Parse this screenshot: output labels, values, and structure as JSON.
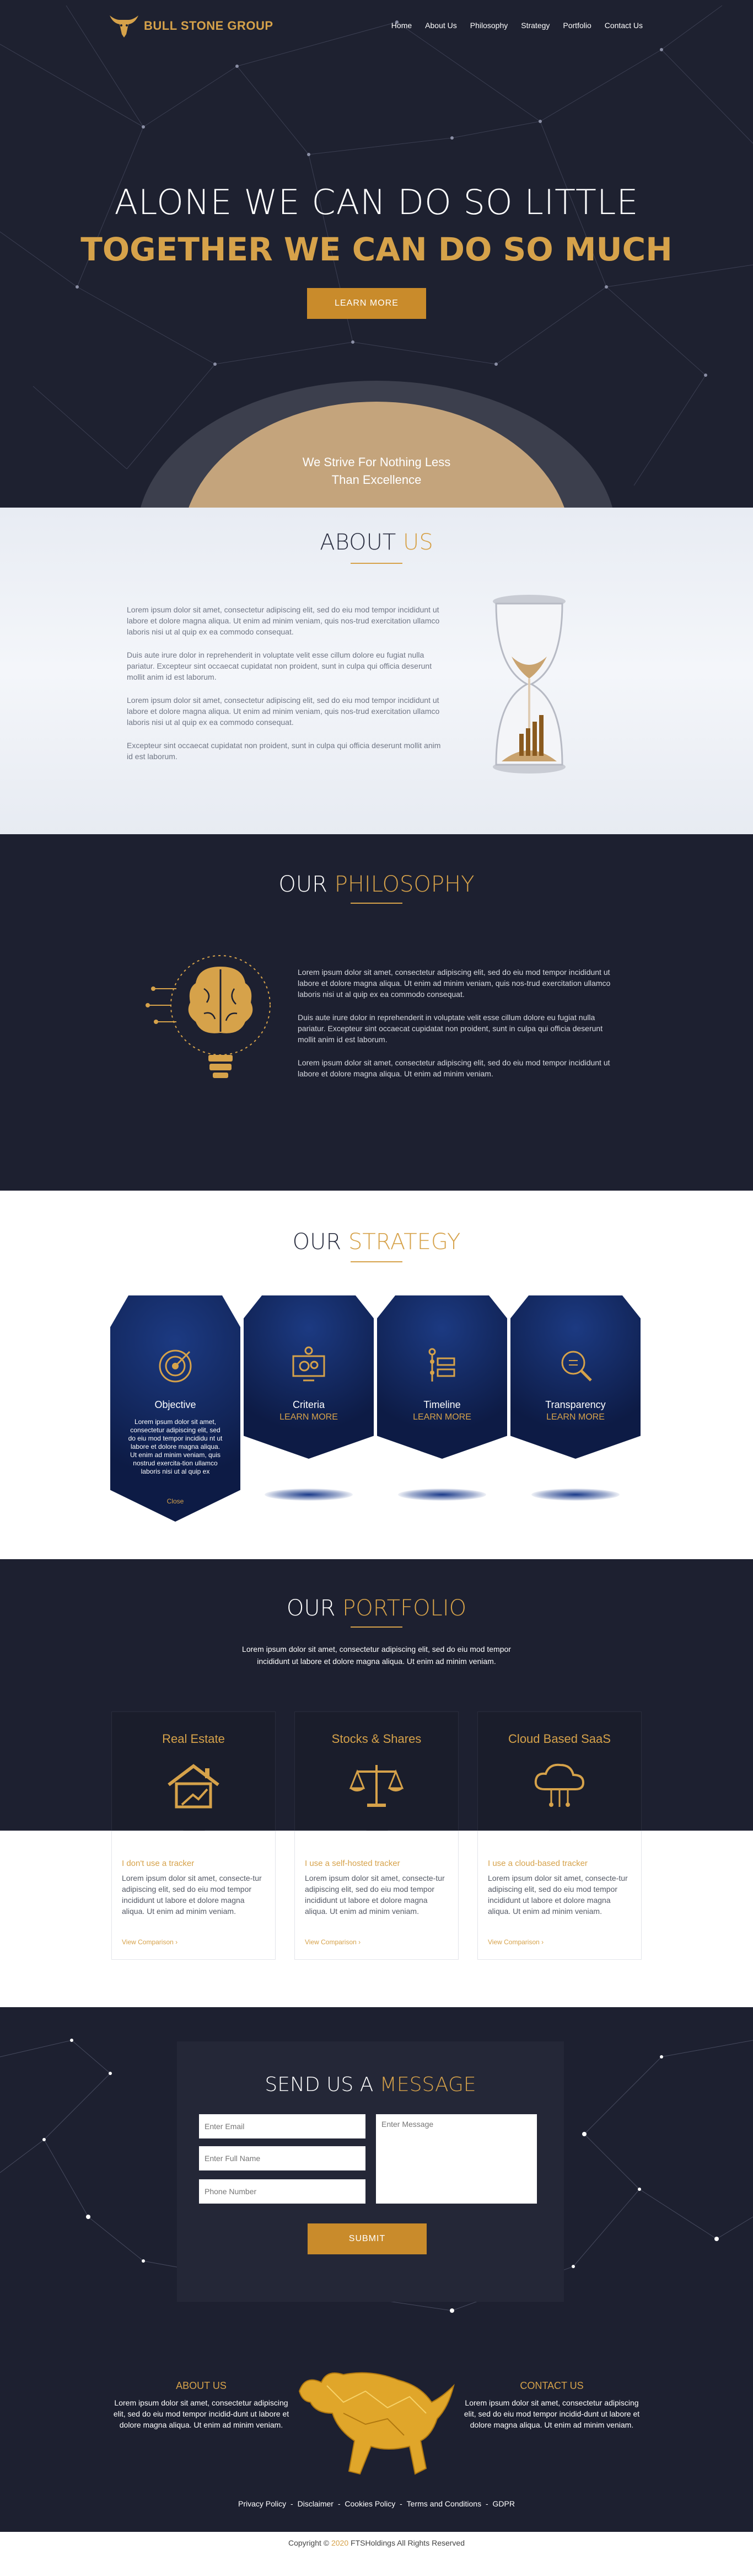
{
  "brand": {
    "name": "BULL STONE GROUP",
    "accent": "#d6a24a",
    "dark": "#1d2030"
  },
  "nav": {
    "items": [
      "Home",
      "About Us",
      "Philosophy",
      "Strategy",
      "Portfolio",
      "Contact Us"
    ]
  },
  "hero": {
    "line1": "ALONE WE CAN DO SO LITTLE",
    "line2": "TOGETHER WE CAN DO SO MUCH",
    "button": "LEARN MORE",
    "tagline1": "We Strive For Nothing Less",
    "tagline2": "Than Excellence"
  },
  "about": {
    "title_pre": "ABOUT ",
    "title_acc": "US",
    "paragraphs": [
      "Lorem ipsum dolor sit amet, consectetur adipiscing elit, sed do eiu mod tempor incididunt ut labore et dolore magna aliqua. Ut enim ad minim veniam, quis nos-trud exercitation ullamco laboris nisi ut al quip ex ea commodo consequat.",
      "Duis aute irure dolor in reprehenderit in voluptate velit esse cillum dolore eu fugiat nulla pariatur. Excepteur sint occaecat cupidatat non proident, sunt in culpa qui officia deserunt mollit anim id est laborum.",
      "Lorem ipsum dolor sit amet, consectetur adipiscing elit, sed do eiu mod tempor incididunt ut labore et dolore magna aliqua. Ut enim ad minim veniam, quis nos-trud exercitation ullamco laboris nisi ut al quip ex ea commodo consequat.",
      "Excepteur sint occaecat cupidatat non proident, sunt in culpa qui officia deserunt mollit anim id est laborum."
    ]
  },
  "philosophy": {
    "title_pre": "OUR ",
    "title_acc": "PHILOSOPHY",
    "paragraphs": [
      "Lorem ipsum dolor sit amet, consectetur adipiscing elit, sed do eiu mod tempor incididunt ut labore et dolore magna aliqua. Ut enim ad minim veniam, quis nos-trud exercitation ullamco laboris nisi ut al quip ex ea commodo consequat.",
      "Duis aute irure dolor in reprehenderit in voluptate velit esse cillum dolore eu fugiat nulla pariatur. Excepteur sint occaecat cupidatat non proident, sunt in culpa qui officia deserunt mollit anim id est laborum.",
      "Lorem ipsum dolor sit amet, consectetur adipiscing elit, sed do eiu mod tempor incididunt ut labore et dolore magna aliqua. Ut enim ad minim veniam."
    ]
  },
  "strategy": {
    "title_pre": "OUR ",
    "title_acc": "STRATEGY",
    "cards": [
      {
        "title": "Objective",
        "body": "Lorem ipsum dolor sit amet, consectetur adipiscing elit, sed do eiu mod tempor incididu nt ut labore et dolore magna aliqua. Ut enim ad minim veniam, quis nostrud exercita-tion ullamco laboris nisi ut al quip ex",
        "link": "Close",
        "icon": "target-icon"
      },
      {
        "title": "Criteria",
        "link": "LEARN MORE",
        "icon": "monitor-gears-icon"
      },
      {
        "title": "Timeline",
        "link": "LEARN MORE",
        "icon": "timeline-icon"
      },
      {
        "title": "Transparency",
        "link": "LEARN MORE",
        "icon": "magnifier-icon"
      }
    ]
  },
  "portfolio": {
    "title_pre": "OUR ",
    "title_acc": "PORTFOLIO",
    "subtitle1": "Lorem ipsum dolor sit amet, consectetur adipiscing elit, sed do eiu mod tempor",
    "subtitle2": "incididunt ut labore et dolore magna aliqua. Ut enim ad minim veniam.",
    "cards": [
      {
        "title": "Real Estate",
        "tag": "I don't use a tracker",
        "desc": "Lorem ipsum dolor sit amet, consecte-tur adipiscing elit, sed do eiu mod tempor incididunt ut labore et dolore magna aliqua. Ut enim ad minim veniam.",
        "link": "View Comparison ›",
        "icon": "house-icon"
      },
      {
        "title": "Stocks & Shares",
        "tag": "I use a self-hosted tracker",
        "desc": "Lorem ipsum dolor sit amet, consecte-tur adipiscing elit, sed do eiu mod tempor incididunt ut labore et dolore magna aliqua. Ut enim ad minim veniam.",
        "link": "View Comparison ›",
        "icon": "scales-icon"
      },
      {
        "title": "Cloud Based SaaS",
        "tag": "I use a cloud-based tracker",
        "desc": "Lorem ipsum dolor sit amet, consecte-tur adipiscing elit, sed do eiu mod tempor incididunt ut labore et dolore magna aliqua. Ut enim ad minim veniam.",
        "link": "View Comparison ›",
        "icon": "cloud-icon"
      }
    ]
  },
  "contact": {
    "title_pre": "SEND US A ",
    "title_acc": "MESSAGE",
    "email_placeholder": "Enter Email",
    "name_placeholder": "Enter Full Name",
    "phone_placeholder": "Phone Number",
    "message_placeholder": "Enter Message",
    "submit": "SUBMIT"
  },
  "footer": {
    "about_title": "ABOUT US",
    "about_body": "Lorem ipsum dolor sit amet, consectetur adipiscing elit, sed do eiu mod tempor incidid-dunt ut labore et dolore magna aliqua. Ut enim ad minim veniam.",
    "contact_title": "CONTACT US",
    "contact_body": "Lorem ipsum dolor sit amet, consectetur adipiscing elit, sed do eiu mod tempor incidid-dunt ut labore et dolore magna aliqua. Ut enim ad minim veniam.",
    "links": [
      "Privacy Policy",
      "Disclaimer",
      "Cookies Policy",
      "Terms and Conditions",
      "GDPR"
    ],
    "copyright_pre": "Copyright © ",
    "copyright_year": "2020",
    "copyright_post": " FTSHoldings All Rights Reserved"
  }
}
